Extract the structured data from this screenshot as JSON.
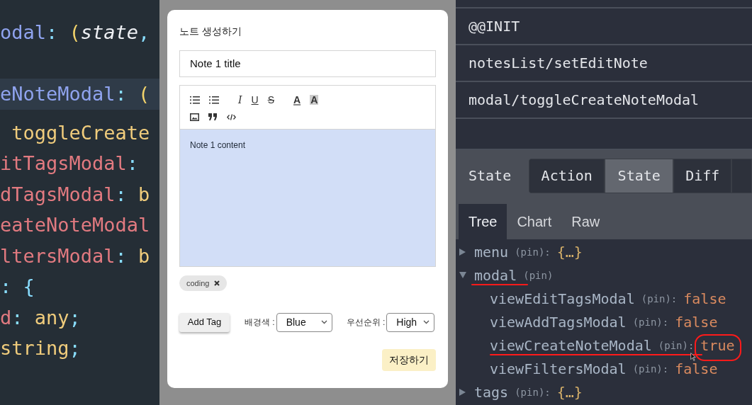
{
  "code_editor": {
    "lines": [
      {
        "highlighted": false,
        "tokens": [
          {
            "text": "odal",
            "color": "#8fa3ee",
            "italic": false
          },
          {
            "text": ":",
            "color": "#89ddff",
            "italic": false
          },
          {
            "text": " (",
            "color": "#f2d36b",
            "italic": false
          },
          {
            "text": "state",
            "color": "#eef0f4",
            "italic": true
          },
          {
            "text": ",",
            "color": "#89ddff",
            "italic": false
          }
        ]
      },
      {
        "highlighted": true,
        "tokens": [
          {
            "text": "eNoteModal",
            "color": "#8fa3ee",
            "italic": false
          },
          {
            "text": ":",
            "color": "#89ddff",
            "italic": false
          },
          {
            "text": " (",
            "color": "#f2d36b",
            "italic": false
          }
        ]
      },
      {
        "highlighted": false,
        "tokens": [
          {
            "text": " toggleCreate",
            "color": "#f0cc7c",
            "italic": false
          }
        ]
      },
      {
        "highlighted": false,
        "tokens": [
          {
            "text": "itTagsModal",
            "color": "#e27a80",
            "italic": false
          },
          {
            "text": ":",
            "color": "#89ddff",
            "italic": false
          }
        ]
      },
      {
        "highlighted": false,
        "tokens": [
          {
            "text": "dTagsModal",
            "color": "#e27a80",
            "italic": false
          },
          {
            "text": ":",
            "color": "#89ddff",
            "italic": false
          },
          {
            "text": " b",
            "color": "#f0cc7c",
            "italic": false
          }
        ]
      },
      {
        "highlighted": false,
        "tokens": [
          {
            "text": "eateNoteModal",
            "color": "#e27a80",
            "italic": false
          }
        ]
      },
      {
        "highlighted": false,
        "tokens": [
          {
            "text": "ltersModal",
            "color": "#e27a80",
            "italic": false
          },
          {
            "text": ":",
            "color": "#89ddff",
            "italic": false
          },
          {
            "text": " b",
            "color": "#f0cc7c",
            "italic": false
          }
        ]
      },
      {
        "highlighted": false,
        "tokens": [
          {
            "text": ":",
            "color": "#89ddff",
            "italic": false
          },
          {
            "text": " {",
            "color": "#89ddff",
            "italic": false
          }
        ]
      },
      {
        "highlighted": false,
        "tokens": [
          {
            "text": "d",
            "color": "#e27a80",
            "italic": false
          },
          {
            "text": ":",
            "color": "#89ddff",
            "italic": false
          },
          {
            "text": " any",
            "color": "#f0cc7c",
            "italic": false
          },
          {
            "text": ";",
            "color": "#89ddff",
            "italic": false
          }
        ]
      },
      {
        "highlighted": false,
        "tokens": [
          {
            "text": "string",
            "color": "#f0cc7c",
            "italic": false
          },
          {
            "text": ";",
            "color": "#89ddff",
            "italic": false
          }
        ]
      }
    ]
  },
  "modal": {
    "title": "노트 생성하기",
    "title_input": {
      "value": "Note 1 title"
    },
    "toolbar": [
      [
        [
          {
            "kind": "ordered-list"
          },
          {
            "kind": "bullet-list"
          }
        ],
        [
          {
            "kind": "italic",
            "glyph": "I"
          },
          {
            "kind": "underline",
            "glyph": "U"
          },
          {
            "kind": "strike",
            "glyph": "S"
          }
        ],
        [
          {
            "kind": "font-color",
            "glyph": "A"
          },
          {
            "kind": "highlight",
            "glyph": "A"
          }
        ]
      ],
      [
        [
          {
            "kind": "image"
          },
          {
            "kind": "quote"
          },
          {
            "kind": "code"
          }
        ]
      ]
    ],
    "content": "Note 1 content",
    "tags": [
      {
        "label": "coding"
      }
    ],
    "add_tag_button": "Add Tag",
    "background_label": "배경색 :",
    "background_select": "Blue",
    "priority_label": "우선순위 :",
    "priority_select": "High",
    "save_button": "저장하기"
  },
  "devtools": {
    "actions": [
      {
        "label": "@@INIT"
      },
      {
        "label": "notesList/setEditNote"
      },
      {
        "label": "modal/toggleCreateNoteModal"
      }
    ],
    "panel_title": "State",
    "tabs": [
      {
        "label": "Action",
        "selected": false
      },
      {
        "label": "State",
        "selected": true
      },
      {
        "label": "Diff",
        "selected": false
      }
    ],
    "view_tabs": [
      {
        "label": "Tree",
        "selected": true
      },
      {
        "label": "Chart",
        "selected": false
      },
      {
        "label": "Raw",
        "selected": false
      }
    ],
    "tree": [
      {
        "key": "menu",
        "pin": "(pin):",
        "value": "{…}",
        "kind": "object",
        "expanded": false,
        "underlined": false
      },
      {
        "key": "modal",
        "pin": "(pin)",
        "expanded": true,
        "underlined": true,
        "children": [
          {
            "key": "viewEditTagsModal",
            "pin": "(pin):",
            "value": "false",
            "kind": "boolean",
            "underlined": false,
            "circled": false
          },
          {
            "key": "viewAddTagsModal",
            "pin": "(pin):",
            "value": "false",
            "kind": "boolean",
            "underlined": false,
            "circled": false
          },
          {
            "key": "viewCreateNoteModal",
            "pin": "(pin):",
            "value": "true",
            "kind": "boolean",
            "underlined": true,
            "circled": true
          },
          {
            "key": "viewFiltersModal",
            "pin": "(pin):",
            "value": "false",
            "kind": "boolean",
            "underlined": false,
            "circled": false
          }
        ]
      },
      {
        "key": "tags",
        "pin": "(pin):",
        "value": "{…}",
        "kind": "object",
        "expanded": false,
        "underlined": false
      }
    ]
  }
}
